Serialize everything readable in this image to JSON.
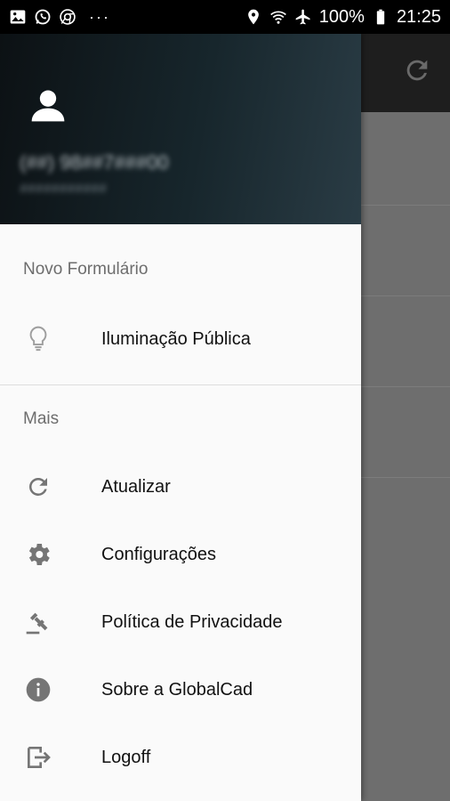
{
  "status_bar": {
    "left_icons": [
      "gallery-icon",
      "whatsapp-icon",
      "chrome-icon"
    ],
    "more": "···",
    "battery": "100%",
    "time": "21:25",
    "right_icons": [
      "location-icon",
      "wifi-icon",
      "airplane-icon",
      "battery-icon"
    ]
  },
  "drawer": {
    "header": {
      "user_name": "(##) 98##7###00",
      "user_sub": "###########"
    },
    "sections": [
      {
        "title": "Novo Formulário",
        "items": [
          {
            "label": "Iluminação Pública",
            "icon": "lightbulb-icon"
          }
        ]
      },
      {
        "title": "Mais",
        "items": [
          {
            "label": "Atualizar",
            "icon": "refresh-icon"
          },
          {
            "label": "Configurações",
            "icon": "gear-icon"
          },
          {
            "label": "Política de Privacidade",
            "icon": "gavel-icon"
          },
          {
            "label": "Sobre a GlobalCad",
            "icon": "info-icon"
          },
          {
            "label": "Logoff",
            "icon": "exit-icon"
          }
        ]
      }
    ]
  },
  "colors": {
    "status_bar": "#000000",
    "drawer_bg": "#fafafa",
    "header_dark": "#0c1114",
    "header_teal": "#2a3c45",
    "icon_gray": "#757575",
    "text_dark": "#111111",
    "section_gray": "#6d6d6d"
  }
}
